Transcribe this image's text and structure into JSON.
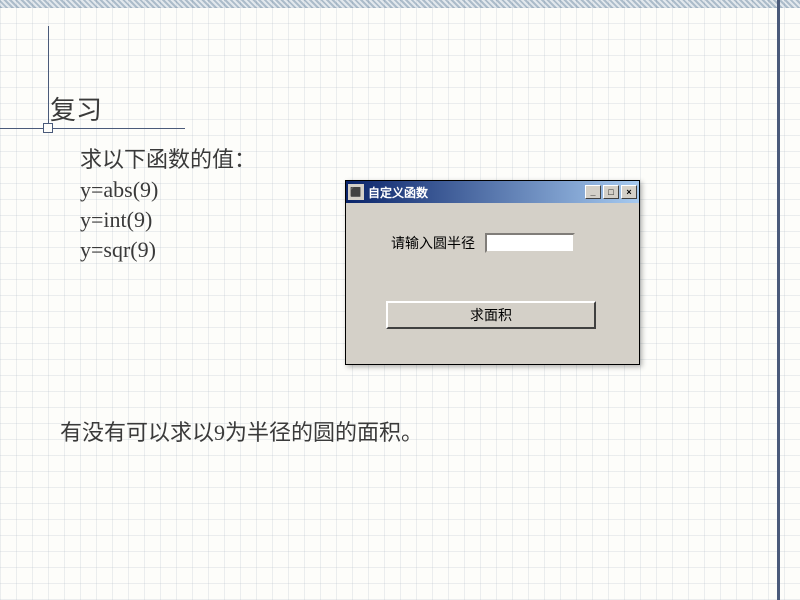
{
  "slide": {
    "title": "复习",
    "prompt": "求以下函数的值：",
    "equations": [
      "y=abs(9)",
      "y=int(9)",
      "y=sqr(9)"
    ],
    "question": "有没有可以求以9为半径的圆的面积。"
  },
  "window": {
    "title": "自定义函数",
    "form_label": "请输入圆半径",
    "input_value": "",
    "button_label": "求面积",
    "min_label": "_",
    "max_label": "□",
    "close_label": "×"
  }
}
